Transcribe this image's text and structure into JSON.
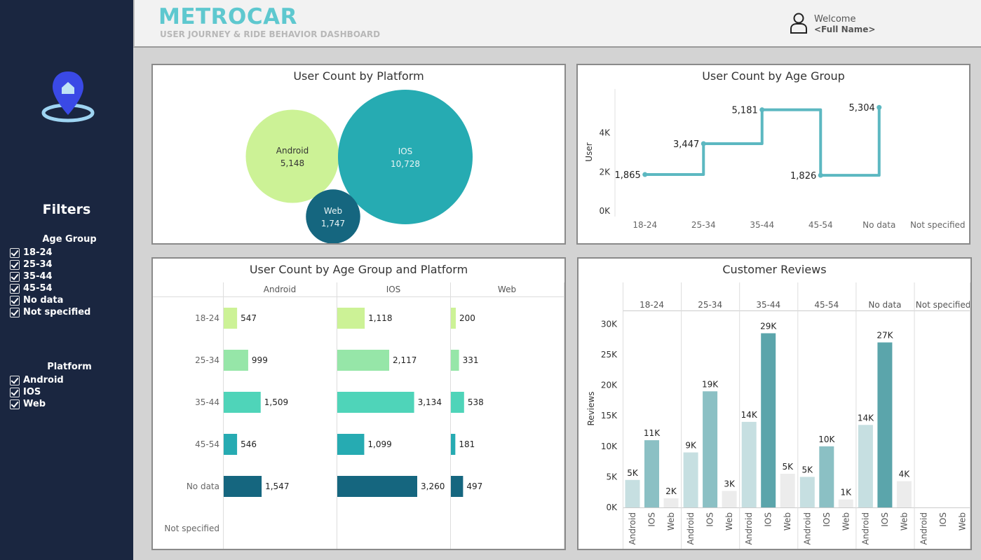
{
  "header": {
    "brand": "METROCAR",
    "subtitle": "USER JOURNEY & RIDE BEHAVIOR DASHBOARD",
    "welcome": "Welcome",
    "user_name": "<Full Name>"
  },
  "sidebar": {
    "filters_title": "Filters",
    "age_group": {
      "label": "Age Group",
      "options": [
        "18-24",
        "25-34",
        "35-44",
        "45-54",
        "No data",
        "Not specified"
      ]
    },
    "platform": {
      "label": "Platform",
      "options": [
        "Android",
        "IOS",
        "Web"
      ]
    }
  },
  "panels": {
    "platform_title": "User Count by Platform",
    "age_title": "User Count by Age Group",
    "age_platform_title": "User Count by Age Group and Platform",
    "reviews_title": "Customer Reviews"
  },
  "chart_data": [
    {
      "type": "bubble",
      "title": "User Count by Platform",
      "categories": [
        "Android",
        "IOS",
        "Web"
      ],
      "values": [
        5148,
        10728,
        1747
      ],
      "labels": [
        "5,148",
        "10,728",
        "1,747"
      ],
      "colors": [
        "#ccf296",
        "#26abb2",
        "#15667f"
      ]
    },
    {
      "type": "line",
      "title": "User Count by Age Group",
      "ylabel": "User",
      "categories": [
        "18-24",
        "25-34",
        "35-44",
        "45-54",
        "No data",
        "Not specified"
      ],
      "values": [
        1865,
        3447,
        5181,
        1826,
        5304,
        null
      ],
      "labels": [
        "1,865",
        "3,447",
        "5,181",
        "1,826",
        "5,304"
      ],
      "yticks": [
        "0K",
        "2K",
        "4K"
      ],
      "ylim": [
        0,
        5600
      ],
      "color": "#5cb8c1"
    },
    {
      "type": "bar",
      "title": "User Count by Age Group and Platform",
      "categories": [
        "18-24",
        "25-34",
        "35-44",
        "45-54",
        "No data",
        "Not specified"
      ],
      "series": [
        {
          "name": "Android",
          "values": [
            547,
            999,
            1509,
            546,
            1547,
            null
          ],
          "labels": [
            "547",
            "999",
            "1,509",
            "546",
            "1,547",
            ""
          ]
        },
        {
          "name": "IOS",
          "values": [
            1118,
            2117,
            3134,
            1099,
            3260,
            null
          ],
          "labels": [
            "1,118",
            "2,117",
            "3,134",
            "1,099",
            "3,260",
            ""
          ]
        },
        {
          "name": "Web",
          "values": [
            200,
            331,
            538,
            181,
            497,
            null
          ],
          "labels": [
            "200",
            "331",
            "538",
            "181",
            "497",
            ""
          ]
        }
      ],
      "colors": [
        "#ccf296",
        "#96e6a8",
        "#4fd4b9",
        "#26abb2",
        "#15667f"
      ]
    },
    {
      "type": "bar",
      "title": "Customer Reviews",
      "ylabel": "Reviews",
      "groups": [
        "18-24",
        "25-34",
        "35-44",
        "45-54",
        "No data",
        "Not specified"
      ],
      "platforms": [
        "Android",
        "IOS",
        "Web"
      ],
      "values": [
        [
          4.5,
          11,
          1.5
        ],
        [
          9,
          19,
          2.7
        ],
        [
          14,
          28.5,
          5.5
        ],
        [
          5,
          10,
          1.3
        ],
        [
          13.5,
          27,
          4.3
        ],
        [
          0,
          0,
          0
        ]
      ],
      "labels": [
        [
          "5K",
          "11K",
          "2K"
        ],
        [
          "9K",
          "19K",
          "3K"
        ],
        [
          "14K",
          "29K",
          "5K"
        ],
        [
          "5K",
          "10K",
          "1K"
        ],
        [
          "14K",
          "27K",
          "4K"
        ],
        [
          "",
          "",
          ""
        ]
      ],
      "yticks": [
        "0K",
        "5K",
        "10K",
        "15K",
        "20K",
        "25K",
        "30K"
      ],
      "ylim": [
        0,
        30
      ],
      "colors": {
        "Android": "#c6dfe1",
        "IOS": "#8bc0c4",
        "Web": "#ececec",
        "max": "#5ba5ab"
      }
    }
  ]
}
